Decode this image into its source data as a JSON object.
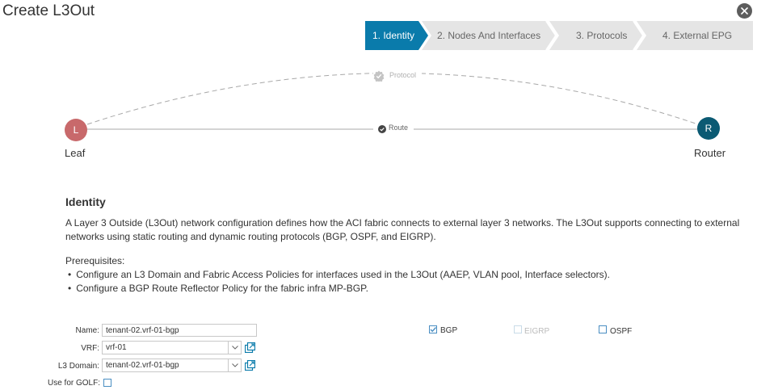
{
  "window": {
    "title": "Create L3Out"
  },
  "wizard": {
    "steps": [
      {
        "label": "1. Identity",
        "active": true
      },
      {
        "label": "2. Nodes And Interfaces",
        "active": false
      },
      {
        "label": "3. Protocols",
        "active": false
      },
      {
        "label": "4. External EPG",
        "active": false
      }
    ]
  },
  "diagram": {
    "leaf": {
      "initial": "L",
      "label": "Leaf",
      "color": "#c8696b"
    },
    "router": {
      "initial": "R",
      "label": "Router",
      "color": "#0b5a73"
    },
    "protocol_label": "Protocol",
    "route_label": "Route"
  },
  "identity": {
    "heading": "Identity",
    "description": "A Layer 3 Outside (L3Out) network configuration defines how the ACI fabric connects to external layer 3 networks. The L3Out supports connecting to external networks using static routing and dynamic routing protocols (BGP, OSPF, and EIGRP).",
    "prereq_title": "Prerequisites:",
    "prereqs": [
      "Configure an L3 Domain and Fabric Access Policies for interfaces used in the L3Out (AAEP, VLAN pool, Interface selectors).",
      "Configure a BGP Route Reflector Policy for the fabric infra MP-BGP."
    ]
  },
  "form": {
    "name_label": "Name:",
    "name_value": "tenant-02.vrf-01-bgp",
    "vrf_label": "VRF:",
    "vrf_value": "vrf-01",
    "domain_label": "L3 Domain:",
    "domain_value": "tenant-02.vrf-01-bgp",
    "golf_label": "Use for GOLF:",
    "golf_checked": false
  },
  "protocols": [
    {
      "label": "BGP",
      "checked": true,
      "enabled": true
    },
    {
      "label": "EIGRP",
      "checked": false,
      "enabled": false
    },
    {
      "label": "OSPF",
      "checked": false,
      "enabled": true
    }
  ],
  "colors": {
    "accent": "#0a7bab",
    "step_inactive": "#e5e5e5",
    "checkbox": "#4a8ec2"
  },
  "icons": {
    "close": "close-icon",
    "external_link": "external-link-icon",
    "dropdown": "chevron-down-icon",
    "protocol": "shield-check-icon",
    "route": "check-circle-icon"
  }
}
